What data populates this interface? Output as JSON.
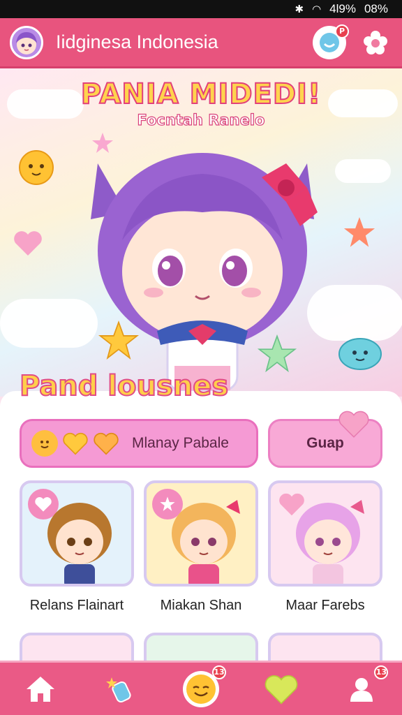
{
  "status_bar": {
    "battery_text": "08%",
    "signal_text": "4l9%"
  },
  "header": {
    "title": "Iidginesa Indonesia",
    "notif_badge": "P"
  },
  "hero": {
    "title": "PANIA MIDEDI!",
    "subtitle": "Focntah Ranelo"
  },
  "section": {
    "title": "Pand lousnes"
  },
  "pills": {
    "main_label": "Mlanay Pabale",
    "side_label": "Guap"
  },
  "cards": [
    {
      "name": "Relans Flainart"
    },
    {
      "name": "Miakan Shan"
    },
    {
      "name": "Maar Farebs"
    }
  ],
  "bottom_nav": {
    "center_badge": "13",
    "profile_badge": "13"
  },
  "colors": {
    "primary": "#e8547e",
    "accent_pink": "#f59ad4",
    "title_yellow": "#ffd34d",
    "outline_pink": "#e2407a"
  }
}
